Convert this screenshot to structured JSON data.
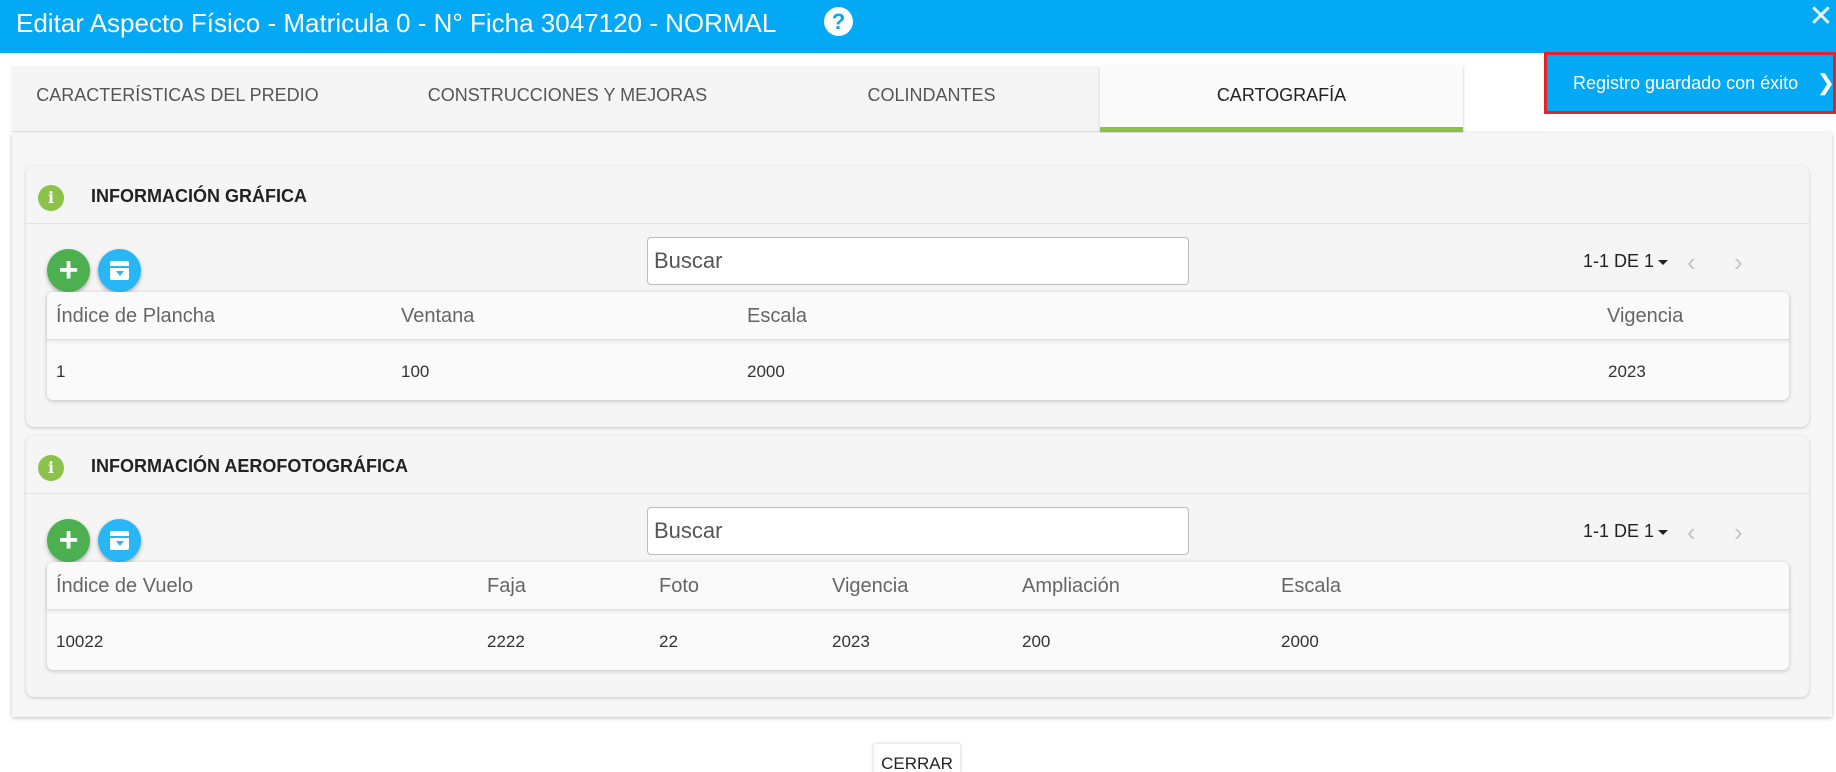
{
  "window": {
    "title": "Editar Aspecto Físico - Matricula 0 - N° Ficha 3047120 - NORMAL",
    "help_label": "?",
    "close_label": "✕"
  },
  "tabs": [
    {
      "label": "CARACTERÍSTICAS DEL PREDIO"
    },
    {
      "label": "CONSTRUCCIONES Y MEJORAS"
    },
    {
      "label": "COLINDANTES"
    },
    {
      "label": "CARTOGRAFÍA"
    }
  ],
  "toast": {
    "message": "Registro guardado con éxito",
    "icon": "chevron-right"
  },
  "graphic": {
    "title": "INFORMACIÓN GRÁFICA",
    "search_placeholder": "Buscar",
    "pagination": "1-1 DE 1",
    "columns": [
      "Índice de Plancha",
      "Ventana",
      "Escala",
      "Vigencia"
    ],
    "rows": [
      [
        "1",
        "100",
        "2000",
        "2023"
      ]
    ]
  },
  "aerial": {
    "title": "INFORMACIÓN AEROFOTOGRÁFICA",
    "search_placeholder": "Buscar",
    "pagination": "1-1 DE 1",
    "columns": [
      "Índice de Vuelo",
      "Faja",
      "Foto",
      "Vigencia",
      "Ampliación",
      "Escala"
    ],
    "rows": [
      [
        "10022",
        "2222",
        "22",
        "2023",
        "200",
        "2000"
      ]
    ]
  },
  "footer": {
    "close_label": "CERRAR"
  },
  "colors": {
    "header": "#03a9f4",
    "active_tab": "#8bc34a",
    "add": "#4caf50",
    "archive": "#29b6f6",
    "highlight": "#e8202a"
  }
}
